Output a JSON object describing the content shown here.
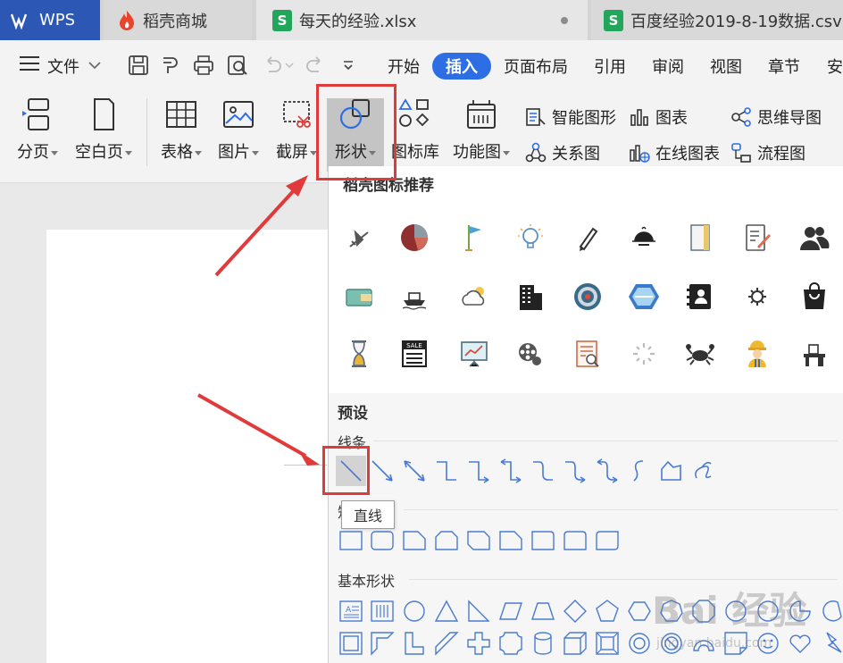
{
  "tabs": {
    "wps": "WPS",
    "daoke": "稻壳商城",
    "xlsx": "每天的经验.xlsx",
    "csv": "百度经验2019-8-19数据.csv"
  },
  "menu": {
    "file": "文件",
    "items": [
      "开始",
      "插入",
      "页面布局",
      "引用",
      "审阅",
      "视图",
      "章节",
      "安"
    ]
  },
  "ribbon": {
    "page_break": "分页",
    "blank_page": "空白页",
    "table": "表格",
    "picture": "图片",
    "screenshot": "截屏",
    "shape": "形状",
    "icon_lib": "图标库",
    "function_chart": "功能图",
    "smart_art": "智能图形",
    "relation": "关系图",
    "chart": "图表",
    "online_chart": "在线图表",
    "mind_map": "思维导图",
    "flowchart": "流程图"
  },
  "panel": {
    "recommend_title": "稻壳图标推荐",
    "preset_title": "预设",
    "lines_label": "线条",
    "rect_label": "矩",
    "basic_label": "基本形状",
    "tooltip": "直线"
  },
  "watermark": {
    "main": "Bai 经验",
    "sub": "jingyan.baidu.com"
  },
  "colors": {
    "accent": "#2d6ee4",
    "wps_blue": "#2d57b4",
    "annotation_red": "#e03a3a",
    "shape_stroke": "#4a7bd0"
  }
}
